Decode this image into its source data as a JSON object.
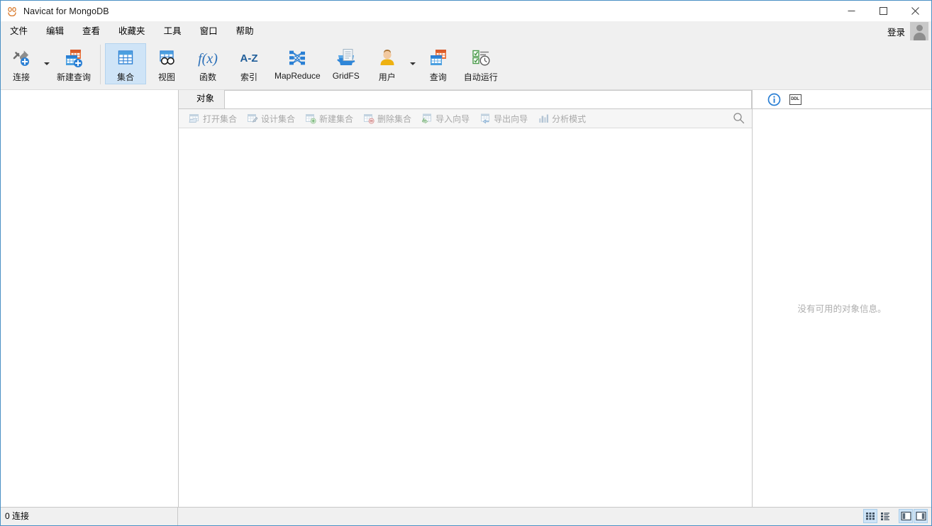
{
  "window": {
    "title": "Navicat for MongoDB",
    "app_icon": "navicat-logo-icon",
    "controls": {
      "minimize": "minimize-icon",
      "maximize": "maximize-icon",
      "close": "close-icon"
    }
  },
  "menubar": {
    "items": [
      {
        "label": "文件"
      },
      {
        "label": "编辑"
      },
      {
        "label": "查看"
      },
      {
        "label": "收藏夹"
      },
      {
        "label": "工具"
      },
      {
        "label": "窗口"
      },
      {
        "label": "帮助"
      }
    ],
    "login_label": "登录",
    "avatar": "user-avatar-icon"
  },
  "toolbar": {
    "groups": [
      {
        "buttons": [
          {
            "label": "连接",
            "icon": "connection-plug-add-icon",
            "has_caret": true,
            "active": false
          },
          {
            "label": "新建查询",
            "icon": "new-query-icon",
            "has_caret": false,
            "active": false
          }
        ]
      },
      {
        "buttons": [
          {
            "label": "集合",
            "icon": "collection-table-icon",
            "has_caret": false,
            "active": true
          },
          {
            "label": "视图",
            "icon": "view-glasses-icon",
            "has_caret": false,
            "active": false
          },
          {
            "label": "函数",
            "icon": "function-fx-icon",
            "has_caret": false,
            "active": false
          },
          {
            "label": "索引",
            "icon": "index-az-icon",
            "has_caret": false,
            "active": false
          },
          {
            "label": "MapReduce",
            "icon": "mapreduce-icon",
            "has_caret": false,
            "active": false
          },
          {
            "label": "GridFS",
            "icon": "gridfs-bucket-icon",
            "has_caret": false,
            "active": false
          },
          {
            "label": "用户",
            "icon": "user-person-icon",
            "has_caret": true,
            "active": false
          },
          {
            "label": "查询",
            "icon": "query-calendar-icon",
            "has_caret": false,
            "active": false
          },
          {
            "label": "自动运行",
            "icon": "automation-clock-icon",
            "has_caret": false,
            "active": false
          }
        ]
      }
    ]
  },
  "main": {
    "tabs": [
      {
        "label": "对象",
        "active": true
      }
    ],
    "object_toolbar": {
      "buttons": [
        {
          "label": "打开集合",
          "icon": "open-collection-icon"
        },
        {
          "label": "设计集合",
          "icon": "design-collection-icon"
        },
        {
          "label": "新建集合",
          "icon": "new-collection-icon"
        },
        {
          "label": "删除集合",
          "icon": "delete-collection-icon"
        },
        {
          "label": "导入向导",
          "icon": "import-wizard-icon"
        },
        {
          "label": "导出向导",
          "icon": "export-wizard-icon"
        },
        {
          "label": "分析模式",
          "icon": "analyze-schema-icon"
        }
      ],
      "search_icon": "search-icon"
    }
  },
  "info_pane": {
    "tabs": [
      {
        "icon": "info-circle-icon",
        "name": "info",
        "active": true
      },
      {
        "icon": "ddl-box-icon",
        "name": "ddl",
        "label": "DDL",
        "active": false
      }
    ],
    "empty_message": "没有可用的对象信息。"
  },
  "statusbar": {
    "connections_text": "0 连接",
    "view_buttons": [
      {
        "icon": "grid-view-icon",
        "name": "grid-view",
        "active": true
      },
      {
        "icon": "list-view-icon",
        "name": "list-view",
        "active": false
      },
      {
        "icon": "left-panel-toggle-icon",
        "name": "left-panel-toggle",
        "active": true
      },
      {
        "icon": "right-panel-toggle-icon",
        "name": "right-panel-toggle",
        "active": true
      }
    ]
  },
  "colors": {
    "accent_blue": "#2a7fd4",
    "window_border": "#4a90c4",
    "chrome_gray": "#f0f0f0",
    "active_tool": "#cfe4f7",
    "muted_text": "#a8a8a8"
  }
}
